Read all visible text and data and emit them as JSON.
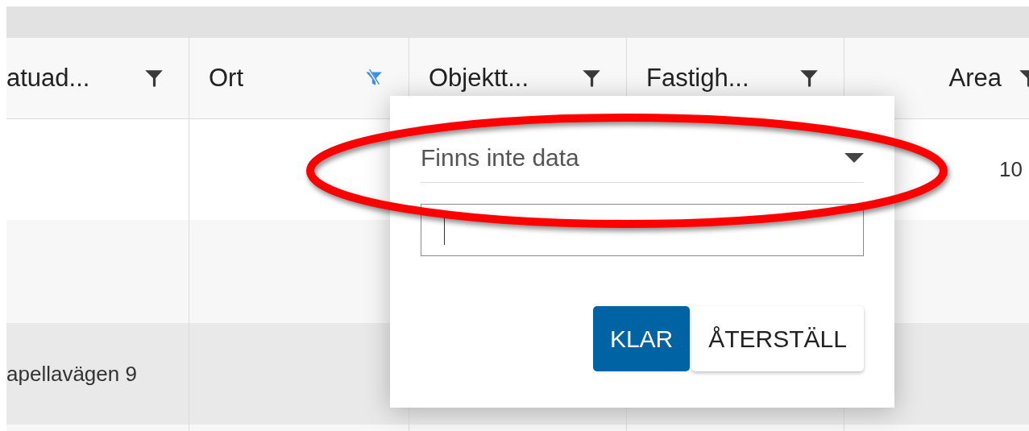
{
  "table": {
    "columns": [
      {
        "label": "atuad...",
        "filter_active": false,
        "kind": "text"
      },
      {
        "label": "Ort",
        "filter_active": true,
        "kind": "text"
      },
      {
        "label": "Objektt...",
        "filter_active": false,
        "kind": "text"
      },
      {
        "label": "Fastigh...",
        "filter_active": false,
        "kind": "text"
      },
      {
        "label": "Area",
        "filter_active": false,
        "kind": "number"
      }
    ],
    "rows": [
      {
        "selected": false,
        "cells": {
          "column_5": "10"
        }
      },
      {
        "selected": false,
        "cells": {}
      },
      {
        "selected": true,
        "cells": {
          "column_1": "apellavägen 9"
        }
      },
      {
        "selected": false,
        "cells": {}
      }
    ]
  },
  "filter_popup": {
    "condition": {
      "value": "Finns inte data"
    },
    "text_field": {
      "focused": true
    },
    "buttons": [
      {
        "label": "KLAR",
        "kind": "primary"
      },
      {
        "label": "ÅTERSTÄLL",
        "kind": "secondary"
      }
    ]
  },
  "annotations": [
    {
      "kind": "ellipse"
    }
  ]
}
